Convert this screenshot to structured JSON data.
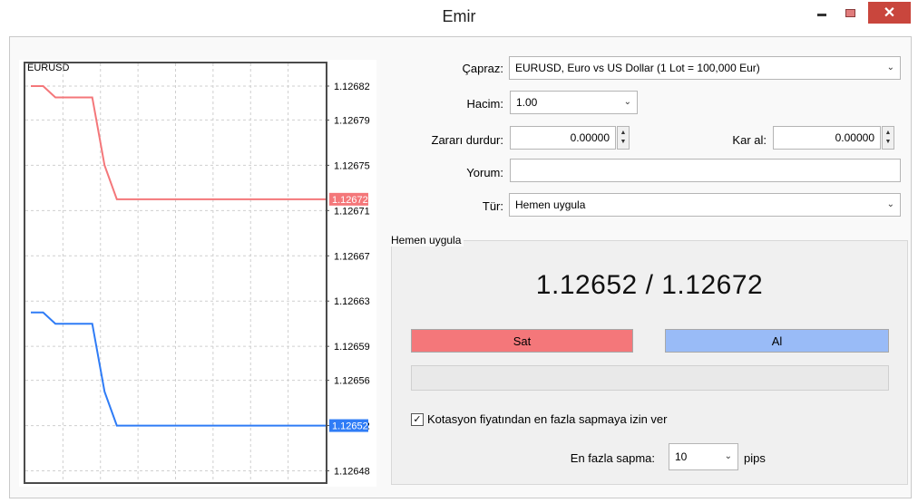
{
  "window": {
    "title": "Emir",
    "minimize_icon": "minimize-icon",
    "maximize_icon": "maximize-icon",
    "close_symbol": "✕"
  },
  "chart": {
    "symbol": "EURUSD",
    "price_labels": [
      "1.12682",
      "1.12679",
      "1.12675",
      "1.12671",
      "1.12667",
      "1.12663",
      "1.12659",
      "1.12656",
      "1.12652",
      "1.12648"
    ],
    "ask_marker": "1.12672",
    "bid_marker": "1.12652",
    "colors": {
      "ask": "#f4777a",
      "bid": "#2f7cf6",
      "grid": "#cfcfcf",
      "frame": "#4b4b4b"
    }
  },
  "chart_data": {
    "type": "line",
    "title": "",
    "x": [
      0,
      1,
      2,
      3,
      4,
      5,
      6,
      7,
      8,
      9,
      10,
      11,
      12,
      13,
      14,
      15,
      16,
      17,
      18,
      19,
      20,
      21,
      22,
      23,
      24
    ],
    "series": [
      {
        "values": [
          1.12682,
          1.12682,
          1.12681,
          1.12681,
          1.12681,
          1.12681,
          1.12675,
          1.12672,
          1.12672,
          1.12672,
          1.12672,
          1.12672,
          1.12672,
          1.12672,
          1.12672,
          1.12672,
          1.12672,
          1.12672,
          1.12672,
          1.12672,
          1.12672,
          1.12672,
          1.12672,
          1.12672,
          1.12672
        ]
      },
      {
        "values": [
          1.12662,
          1.12662,
          1.12661,
          1.12661,
          1.12661,
          1.12661,
          1.12655,
          1.12652,
          1.12652,
          1.12652,
          1.12652,
          1.12652,
          1.12652,
          1.12652,
          1.12652,
          1.12652,
          1.12652,
          1.12652,
          1.12652,
          1.12652,
          1.12652,
          1.12652,
          1.12652,
          1.12652,
          1.12652
        ]
      }
    ],
    "ylim": [
      1.12647,
      1.12684
    ],
    "ytick_labels": [
      "1.12682",
      "1.12679",
      "1.12675",
      "1.12671",
      "1.12667",
      "1.12663",
      "1.12659",
      "1.12656",
      "1.12652",
      "1.12648"
    ],
    "grid": true
  },
  "form": {
    "symbol_label": "Çapraz:",
    "symbol_value": "EURUSD, Euro vs US Dollar (1 Lot = 100,000 Eur)",
    "volume_label": "Hacim:",
    "volume_value": "1.00",
    "stoploss_label": "Zararı durdur:",
    "stoploss_value": "0.00000",
    "takeprofit_label": "Kar al:",
    "takeprofit_value": "0.00000",
    "comment_label": "Yorum:",
    "comment_value": "",
    "type_label": "Tür:",
    "type_value": "Hemen uygula"
  },
  "execution": {
    "group_title": "Hemen uygula",
    "prices": "1.12652 / 1.12672",
    "sell_label": "Sat",
    "buy_label": "Al",
    "sell_color": "#f4777a",
    "buy_color": "#99bbf7",
    "deviation_checkbox_label": "Kotasyon fiyatından en fazla sapmaya izin ver",
    "deviation_checked": true,
    "max_deviation_label": "En fazla sapma:",
    "max_deviation_value": "10",
    "deviation_unit": "pips"
  }
}
